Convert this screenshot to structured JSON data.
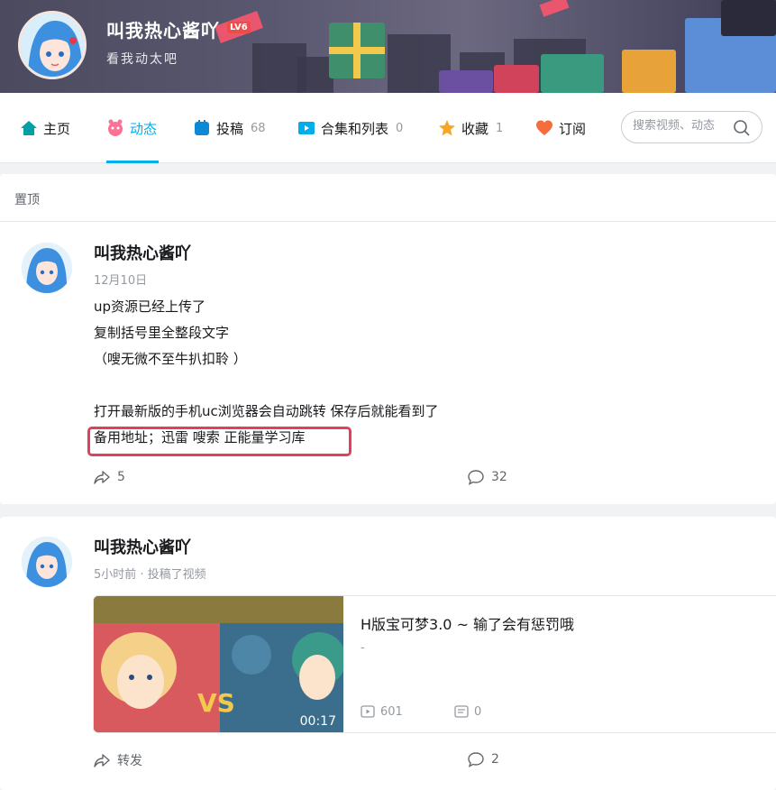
{
  "header": {
    "username": "叫我热心酱吖",
    "level_badge": "LV6",
    "signature": "看我动太吧"
  },
  "nav": {
    "tabs": [
      {
        "label": "主页",
        "count": "",
        "icon": "home-icon",
        "color": "#00a1d6"
      },
      {
        "label": "动态",
        "count": "",
        "icon": "dynamic-icon",
        "color": "#fb7299",
        "active": true
      },
      {
        "label": "投稿",
        "count": "68",
        "icon": "upload-icon",
        "color": "#00aeec"
      },
      {
        "label": "合集和列表",
        "count": "0",
        "icon": "collection-icon",
        "color": "#00aeec"
      },
      {
        "label": "收藏",
        "count": "1",
        "icon": "star-icon",
        "color": "#f6a623"
      },
      {
        "label": "订阅",
        "count": "",
        "icon": "heart-icon",
        "color": "#f56c3d"
      }
    ],
    "search_placeholder": "搜索视频、动态"
  },
  "pinned": {
    "label": "置顶",
    "author": "叫我热心酱吖",
    "date": "12月10日",
    "lines": [
      "up资源已经上传了",
      "复制括号里全整段文字",
      "（嗖无微不至牛扒扣聆 ）",
      "",
      "打开最新版的手机uc浏览器会自动跳转 保存后就能看到了",
      "备用地址；迅雷 嗖索 正能量学习库"
    ],
    "share_count": "5",
    "comment_count": "32"
  },
  "video_post": {
    "author": "叫我热心酱吖",
    "meta": "5小时前 · 投稿了视频",
    "title": "H版宝可梦3.0 ~ 输了会有惩罚哦",
    "desc": "-",
    "duration": "00:17",
    "plays": "601",
    "danmaku": "0",
    "share_label": "转发",
    "comment_count": "2"
  },
  "accent_color": "#00aeec",
  "highlight_color": "#e0405a"
}
